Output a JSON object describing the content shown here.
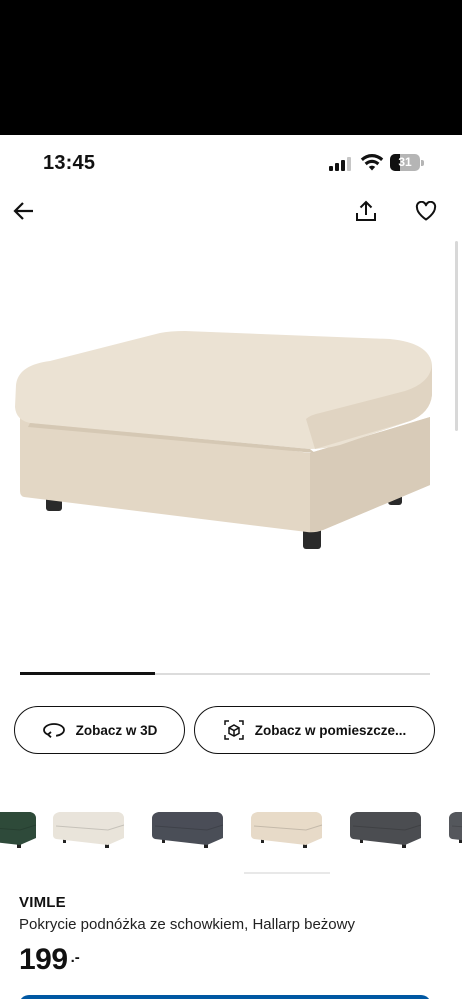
{
  "status_bar": {
    "time": "13:45",
    "battery": "31"
  },
  "nav": {
    "back_icon": "arrow-left-icon",
    "share_icon": "share-icon",
    "favourite_icon": "heart-icon"
  },
  "gallery": {
    "progress": 0.33
  },
  "actions": {
    "view_3d_label": "Zobacz w 3D",
    "view_room_label": "Zobacz w pomieszcze..."
  },
  "swatches": [
    {
      "color": "#2e4a3a",
      "label": "green"
    },
    {
      "color": "#e9e4da",
      "label": "light-beige"
    },
    {
      "color": "#4a4e57",
      "label": "dark-grey"
    },
    {
      "color": "#e7dac8",
      "label": "beige"
    },
    {
      "color": "#4b4d51",
      "label": "charcoal"
    },
    {
      "color": "#55575c",
      "label": "grey"
    }
  ],
  "product": {
    "brand": "VIMLE",
    "description": "Pokrycie podnóżka ze schowkiem, Hallarp beżowy",
    "price_integer": "199",
    "price_decimal": ".-"
  },
  "colors": {
    "accent": "#0058a3",
    "product_fabric": "#e8ddcd"
  }
}
